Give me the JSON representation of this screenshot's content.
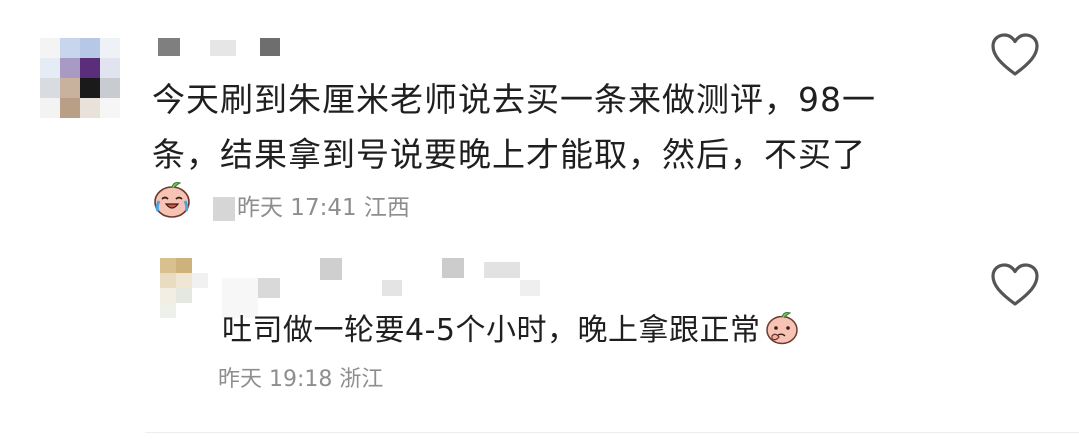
{
  "comments": [
    {
      "text_line1": "今天刷到朱厘米老师说去买一条来做测评，98一",
      "text_line2": "条，结果拿到号说要晚上才能取，然后，不买了",
      "time": "昨天 17:41",
      "location": "江西",
      "reaction_icon": "crying-laughing-peach-sticker",
      "like_icon": "heart-outline-icon"
    },
    {
      "text": "吐司做一轮要4-5个小时，晚上拿跟正常",
      "time": "昨天 19:18",
      "location": "浙江",
      "inline_icon": "thinking-peach-sticker",
      "like_icon": "heart-outline-icon"
    }
  ],
  "colors": {
    "text": "#1f1f1f",
    "meta": "#8e8e8e",
    "heart_stroke": "#555555",
    "sticker_peach": "#f6c3b5"
  }
}
